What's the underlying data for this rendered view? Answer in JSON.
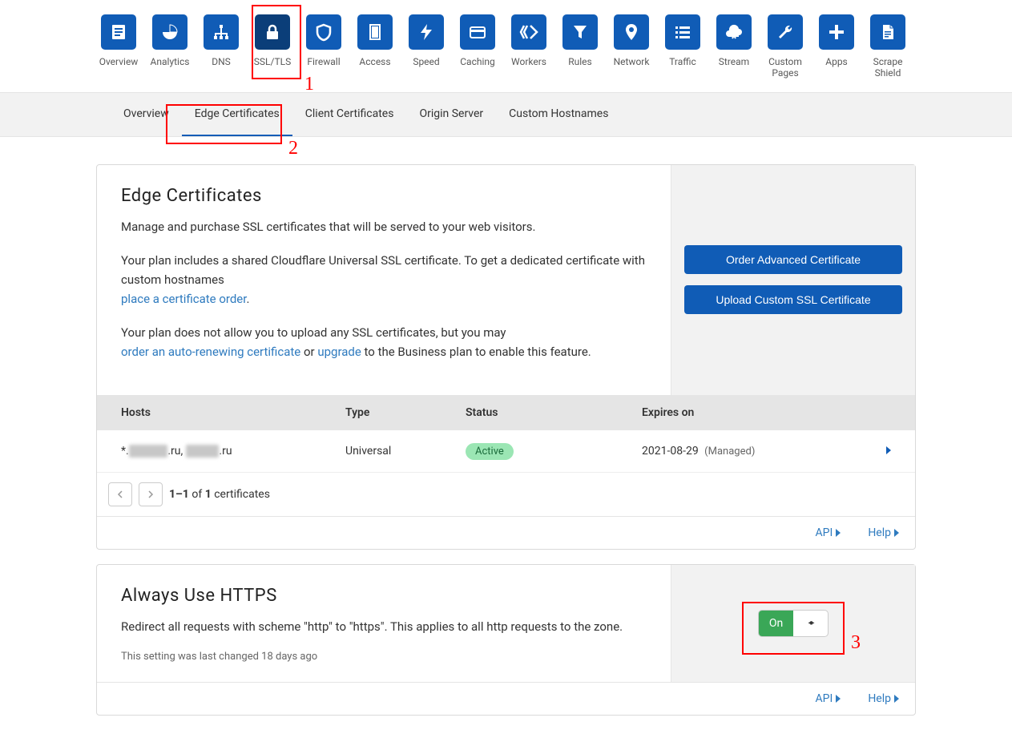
{
  "topnav": [
    {
      "label": "Overview",
      "icon": "doc"
    },
    {
      "label": "Analytics",
      "icon": "pie"
    },
    {
      "label": "DNS",
      "icon": "tree"
    },
    {
      "label": "SSL/TLS",
      "icon": "lock",
      "active": true
    },
    {
      "label": "Firewall",
      "icon": "shield"
    },
    {
      "label": "Access",
      "icon": "door"
    },
    {
      "label": "Speed",
      "icon": "bolt"
    },
    {
      "label": "Caching",
      "icon": "card"
    },
    {
      "label": "Workers",
      "icon": "workers"
    },
    {
      "label": "Rules",
      "icon": "funnel"
    },
    {
      "label": "Network",
      "icon": "pin"
    },
    {
      "label": "Traffic",
      "icon": "list"
    },
    {
      "label": "Stream",
      "icon": "cloud"
    },
    {
      "label": "Custom Pages",
      "icon": "wrench",
      "wide": true
    },
    {
      "label": "Apps",
      "icon": "plus"
    },
    {
      "label": "Scrape Shield",
      "icon": "page",
      "wide": true
    }
  ],
  "subtabs": [
    "Overview",
    "Edge Certificates",
    "Client Certificates",
    "Origin Server",
    "Custom Hostnames"
  ],
  "subtab_active": 1,
  "annotations": {
    "a1": "1",
    "a2": "2",
    "a3": "3"
  },
  "edge": {
    "title": "Edge Certificates",
    "desc": "Manage and purchase SSL certificates that will be served to your web visitors.",
    "p2a": "Your plan includes a shared Cloudflare Universal SSL certificate. To get a dedicated certificate with custom hostnames",
    "p2link": "place a certificate order",
    "p2b": ".",
    "p3a": "Your plan does not allow you to upload any SSL certificates, but you may",
    "p3link1": "order an auto-renewing certificate",
    "p3or": " or ",
    "p3link2": "upgrade",
    "p3b": " to the Business plan to enable this feature.",
    "btn1": "Order Advanced Certificate",
    "btn2": "Upload Custom SSL Certificate",
    "headers": {
      "hosts": "Hosts",
      "type": "Type",
      "status": "Status",
      "exp": "Expires on"
    },
    "row": {
      "host_prefix": "*.",
      "host_mask1": "xxxxxxx",
      "host_mid": ".ru, ",
      "host_mask2": "xxxxxx",
      "host_suffix": ".ru",
      "type": "Universal",
      "status": "Active",
      "exp_date": "2021-08-29",
      "exp_note": "(Managed)"
    },
    "pagination": {
      "text_a": "1–1",
      "text_b": " of ",
      "text_c": "1",
      "text_d": " certificates"
    }
  },
  "footer": {
    "api": "API",
    "help": "Help"
  },
  "https": {
    "title": "Always Use HTTPS",
    "desc": "Redirect all requests with scheme \"http\" to \"https\". This applies to all http requests to the zone.",
    "note": "This setting was last changed 18 days ago",
    "toggle": "On"
  }
}
